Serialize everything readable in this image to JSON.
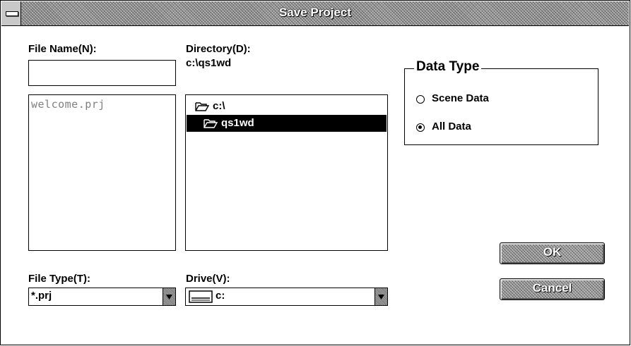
{
  "window": {
    "title": "Save Project"
  },
  "file_name": {
    "label": "File Name(N):",
    "value": ""
  },
  "file_list": {
    "items": [
      "welcome.prj"
    ]
  },
  "directory": {
    "label": "Directory(D):",
    "current_path": "c:\\qs1wd",
    "tree": [
      {
        "label": "c:\\",
        "icon": "open-folder-icon",
        "selected": false
      },
      {
        "label": "qs1wd",
        "icon": "open-folder-icon",
        "selected": true
      }
    ]
  },
  "data_type": {
    "legend": "Data Type",
    "options": [
      {
        "label": "Scene Data",
        "checked": false
      },
      {
        "label": "All Data",
        "checked": true
      }
    ]
  },
  "file_type": {
    "label": "File Type(T):",
    "value": "*.prj"
  },
  "drive": {
    "label": "Drive(V):",
    "value": "c:",
    "icon": "drive-icon"
  },
  "buttons": {
    "ok": "OK",
    "cancel": "Cancel"
  }
}
